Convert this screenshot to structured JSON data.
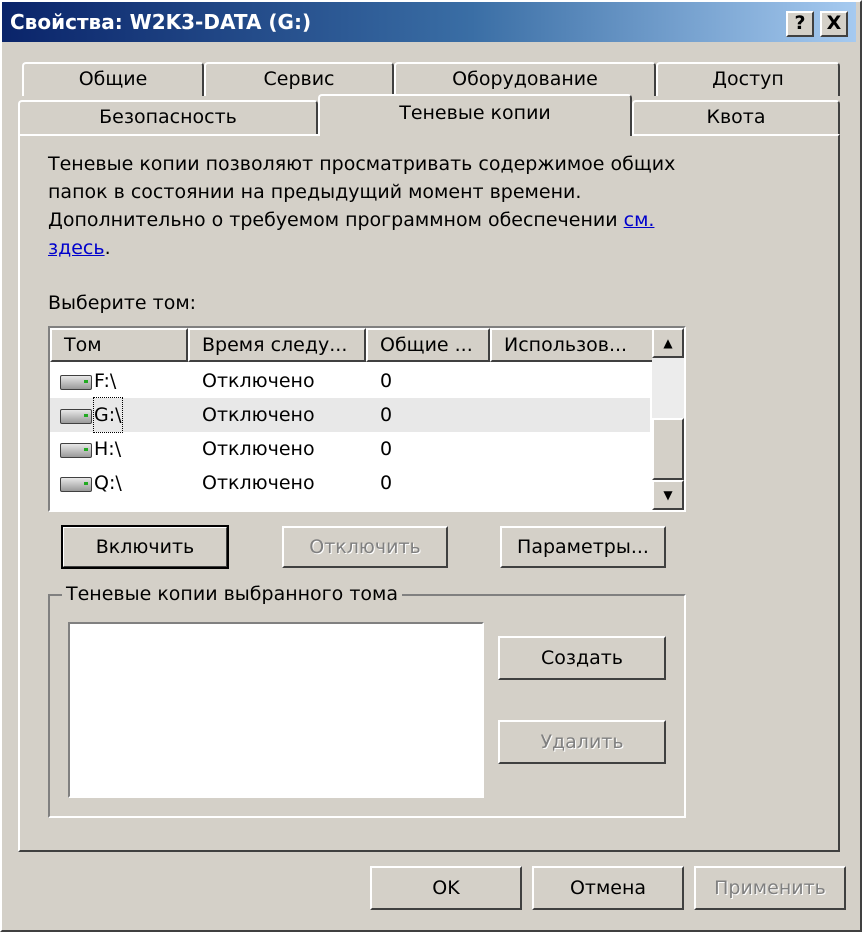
{
  "window": {
    "title": "Свойства: W2K3-DATA (G:)",
    "help_btn": "?",
    "close_btn": "X"
  },
  "tabs": {
    "row1": [
      "Общие",
      "Сервис",
      "Оборудование",
      "Доступ"
    ],
    "row2": [
      "Безопасность",
      "Теневые копии",
      "Квота"
    ],
    "active": "Теневые копии"
  },
  "description": {
    "line1": "Теневые копии позволяют просматривать содержимое общих",
    "line2": "папок в состоянии на предыдущий момент времени.",
    "line3": "Дополнительно о требуемом программном обеспечении ",
    "link_part1": "см.",
    "link_part2": "здесь",
    "tail": "."
  },
  "select_label": "Выберите том:",
  "volumes": {
    "columns": [
      "Том",
      "Время следу...",
      "Общие ...",
      "Использов..."
    ],
    "rows": [
      {
        "volume": "F:\\",
        "next_time": "Отключено",
        "shares": "0",
        "used": ""
      },
      {
        "volume": "G:\\",
        "next_time": "Отключено",
        "shares": "0",
        "used": ""
      },
      {
        "volume": "H:\\",
        "next_time": "Отключено",
        "shares": "0",
        "used": ""
      },
      {
        "volume": "Q:\\",
        "next_time": "Отключено",
        "shares": "0",
        "used": ""
      }
    ],
    "selected_row": 1
  },
  "actions": {
    "enable": "Включить",
    "disable": "Отключить",
    "settings": "Параметры..."
  },
  "snapshots": {
    "group_label": "Теневые копии выбранного тома",
    "create": "Создать",
    "delete": "Удалить"
  },
  "footer": {
    "ok": "OK",
    "cancel": "Отмена",
    "apply": "Применить"
  },
  "colors": {
    "face": "#d4d0c8",
    "title_start": "#0a246a",
    "title_end": "#a6caf0",
    "link": "#0000cc"
  }
}
